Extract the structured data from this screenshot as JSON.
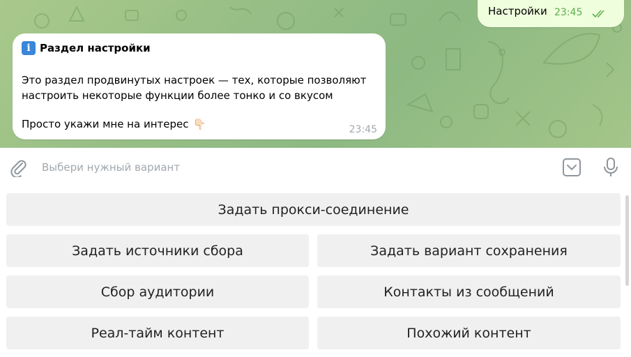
{
  "chat": {
    "outgoing": {
      "text": "Настройки",
      "time": "23:45",
      "status": "read-double-check-icon"
    },
    "incoming": {
      "title_icon": "info-icon",
      "title": "Раздел настройки",
      "body": "Это раздел продвинутых настроек — тех, которые позволяют настроить некоторые функции более тонко и со вкусом",
      "hint": "Просто укажи мне на интерес",
      "hint_emoji": "👇🏻",
      "time": "23:45"
    }
  },
  "input": {
    "placeholder": "Выбери нужный вариант",
    "value": "",
    "icons": [
      "paperclip-icon",
      "keyboard-toggle-icon",
      "microphone-icon"
    ]
  },
  "keyboard": {
    "buttons": [
      "Задать прокси-соединение",
      "Задать источники сбора",
      "Задать вариант сохранения",
      "Сбор аудитории",
      "Контакты из сообщений",
      "Реал-тайм контент",
      "Похожий контент"
    ]
  },
  "colors": {
    "chat_background": "#97be86",
    "outgoing_bubble": "#effedd",
    "incoming_bubble": "#ffffff",
    "outgoing_time": "#5fae4e",
    "button_background": "#f0f0f0",
    "info_badge": "#3a86d9"
  }
}
